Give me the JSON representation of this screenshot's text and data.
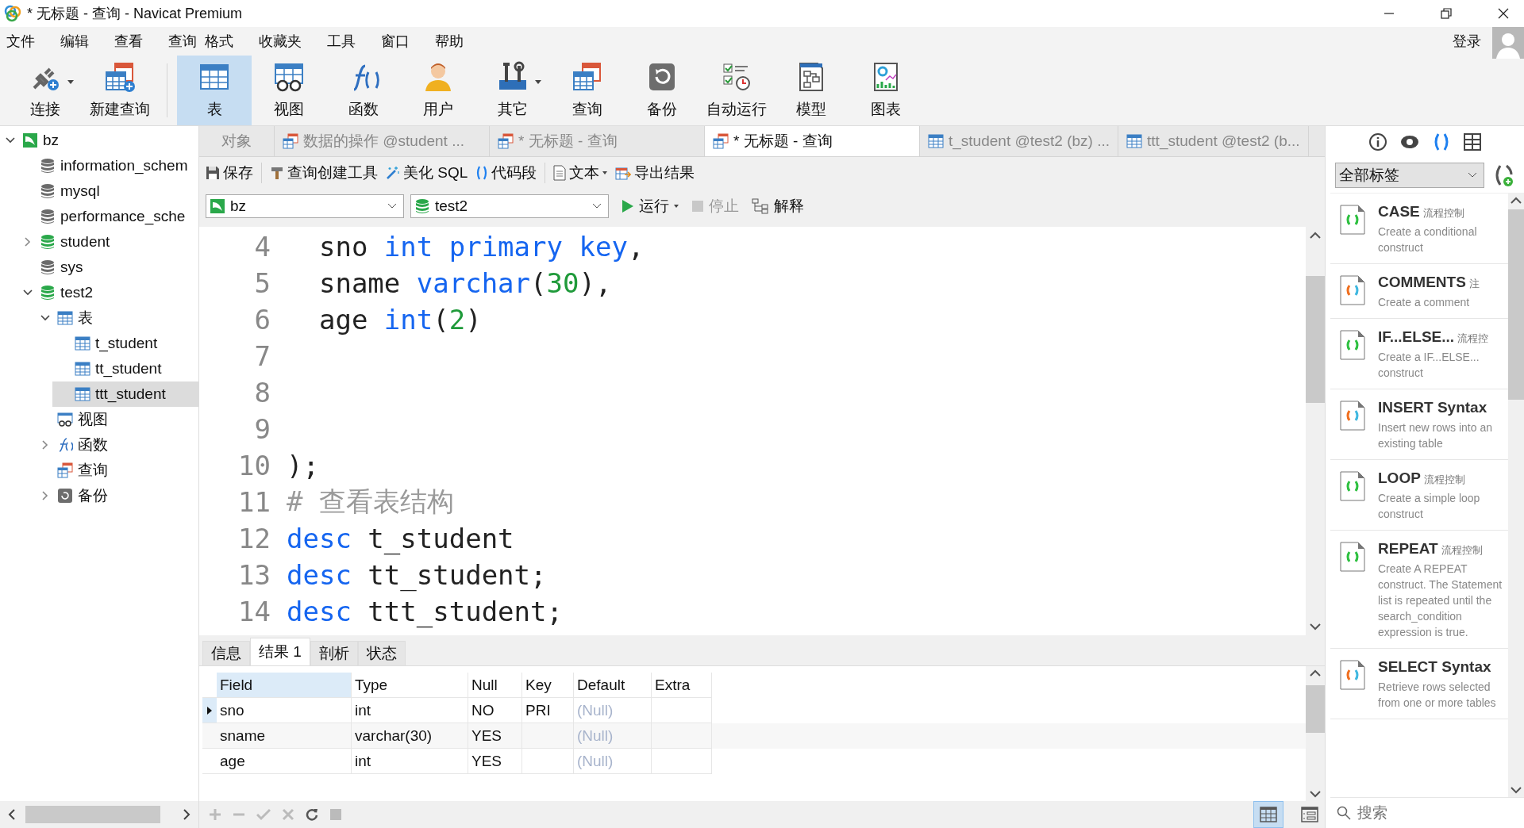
{
  "window": {
    "title": "* 无标题 - 查询 - Navicat Premium"
  },
  "menu": [
    "文件",
    "编辑",
    "查看",
    "查询",
    "格式",
    "收藏夹",
    "工具",
    "窗口",
    "帮助"
  ],
  "account": {
    "login": "登录"
  },
  "toolbar": [
    {
      "label": "连接",
      "kind": "connect",
      "dropdown": true,
      "selected": false
    },
    {
      "label": "新建查询",
      "kind": "newquery",
      "dropdown": false,
      "selected": false
    },
    {
      "label": "表",
      "kind": "table",
      "dropdown": false,
      "selected": true
    },
    {
      "label": "视图",
      "kind": "view",
      "dropdown": false,
      "selected": false
    },
    {
      "label": "函数",
      "kind": "function",
      "dropdown": false,
      "selected": false
    },
    {
      "label": "用户",
      "kind": "user",
      "dropdown": false,
      "selected": false
    },
    {
      "label": "其它",
      "kind": "tools",
      "dropdown": true,
      "selected": false
    },
    {
      "label": "查询",
      "kind": "query",
      "dropdown": false,
      "selected": false
    },
    {
      "label": "备份",
      "kind": "backup",
      "dropdown": false,
      "selected": false
    },
    {
      "label": "自动运行",
      "kind": "autorun",
      "dropdown": false,
      "selected": false
    },
    {
      "label": "模型",
      "kind": "model",
      "dropdown": false,
      "selected": false
    },
    {
      "label": "图表",
      "kind": "chart",
      "dropdown": false,
      "selected": false
    }
  ],
  "tree": [
    {
      "label": "bz",
      "kind": "connection",
      "expanded": true,
      "selected": false,
      "children": [
        {
          "label": "information_schem",
          "kind": "database",
          "selected": false
        },
        {
          "label": "mysql",
          "kind": "database",
          "selected": false
        },
        {
          "label": "performance_sche",
          "kind": "database",
          "selected": false
        },
        {
          "label": "student",
          "kind": "database-open",
          "expanded": false,
          "selected": false
        },
        {
          "label": "sys",
          "kind": "database",
          "selected": false
        },
        {
          "label": "test2",
          "kind": "database-open",
          "expanded": true,
          "selected": false,
          "children": [
            {
              "label": "表",
              "kind": "table",
              "expanded": true,
              "selected": false,
              "children": [
                {
                  "label": "t_student",
                  "kind": "table",
                  "selected": false
                },
                {
                  "label": "tt_student",
                  "kind": "table",
                  "selected": false
                },
                {
                  "label": "ttt_student",
                  "kind": "table",
                  "selected": true
                }
              ]
            },
            {
              "label": "视图",
              "kind": "view",
              "selected": false
            },
            {
              "label": "函数",
              "kind": "function",
              "expanded": false,
              "selected": false
            },
            {
              "label": "查询",
              "kind": "query",
              "selected": false
            },
            {
              "label": "备份",
              "kind": "backup",
              "expanded": false,
              "selected": false
            }
          ]
        }
      ]
    }
  ],
  "doc_tabs": [
    {
      "label": "对象",
      "kind": "object",
      "selected": false
    },
    {
      "label": "数据的操作 @student ...",
      "kind": "query",
      "selected": false
    },
    {
      "label": "* 无标题 - 查询",
      "kind": "query",
      "selected": false
    },
    {
      "label": "* 无标题 - 查询",
      "kind": "query",
      "selected": true
    },
    {
      "label": "t_student @test2 (bz) ...",
      "kind": "table",
      "selected": false
    },
    {
      "label": "ttt_student @test2 (b...",
      "kind": "table",
      "selected": false
    }
  ],
  "query_toolbar": [
    {
      "label": "保存",
      "kind": "save",
      "dropdown": false
    },
    {
      "label": "查询创建工具",
      "kind": "builder",
      "dropdown": false
    },
    {
      "label": "美化 SQL",
      "kind": "beautify",
      "dropdown": false
    },
    {
      "label": "代码段",
      "kind": "snippet",
      "dropdown": false
    },
    {
      "label": "文本",
      "kind": "text",
      "dropdown": true
    },
    {
      "label": "导出结果",
      "kind": "export",
      "dropdown": false
    }
  ],
  "connection_select": {
    "value": "bz"
  },
  "database_select": {
    "value": "test2"
  },
  "run_controls": [
    {
      "label": "运行",
      "kind": "run",
      "dropdown": true,
      "disabled": false
    },
    {
      "label": "停止",
      "kind": "stop",
      "dropdown": false,
      "disabled": true
    },
    {
      "label": "解释",
      "kind": "explain",
      "dropdown": false,
      "disabled": false
    }
  ],
  "editor": {
    "lines": [
      {
        "number": "4",
        "tokens": [
          {
            "text": "  sno ",
            "kind": "plain"
          },
          {
            "text": "int primary key",
            "kind": "keyword"
          },
          {
            "text": ",",
            "kind": "plain"
          }
        ]
      },
      {
        "number": "5",
        "tokens": [
          {
            "text": "  sname ",
            "kind": "plain"
          },
          {
            "text": "varchar",
            "kind": "keyword"
          },
          {
            "text": "(",
            "kind": "plain"
          },
          {
            "text": "30",
            "kind": "number"
          },
          {
            "text": "),",
            "kind": "plain"
          }
        ]
      },
      {
        "number": "6",
        "tokens": [
          {
            "text": "  age ",
            "kind": "plain"
          },
          {
            "text": "int",
            "kind": "keyword"
          },
          {
            "text": "(",
            "kind": "plain"
          },
          {
            "text": "2",
            "kind": "number"
          },
          {
            "text": ")",
            "kind": "plain"
          }
        ]
      },
      {
        "number": "7"
      },
      {
        "number": "8"
      },
      {
        "number": "9"
      },
      {
        "number": "10",
        "tokens": [
          {
            "text": ");",
            "kind": "plain"
          }
        ]
      },
      {
        "number": "11",
        "tokens": [
          {
            "text": "# 查看表结构",
            "kind": "comment"
          }
        ]
      },
      {
        "number": "12",
        "tokens": [
          {
            "text": "desc ",
            "kind": "keyword"
          },
          {
            "text": "t_student",
            "kind": "plain"
          }
        ]
      },
      {
        "number": "13",
        "tokens": [
          {
            "text": "desc ",
            "kind": "keyword"
          },
          {
            "text": "tt_student;",
            "kind": "plain"
          }
        ]
      },
      {
        "number": "14",
        "tokens": [
          {
            "text": "desc ",
            "kind": "keyword"
          },
          {
            "text": "ttt_student;",
            "kind": "plain"
          }
        ]
      }
    ]
  },
  "result_tabs": [
    {
      "label": "信息",
      "selected": false
    },
    {
      "label": "结果 1",
      "selected": true
    },
    {
      "label": "剖析",
      "selected": false
    },
    {
      "label": "状态",
      "selected": false
    }
  ],
  "result_table": {
    "columns": [
      {
        "label": "Field",
        "selected": true
      },
      {
        "label": "Type",
        "selected": false
      },
      {
        "label": "Null",
        "selected": false
      },
      {
        "label": "Key",
        "selected": false
      },
      {
        "label": "Default",
        "selected": false
      },
      {
        "label": "Extra",
        "selected": false
      }
    ],
    "rows": [
      {
        "selected": true,
        "cells": [
          "sno",
          "int",
          "NO",
          "PRI",
          {
            "text": "(Null)",
            "is_null": true
          }
        ]
      },
      {
        "selected": false,
        "cells": [
          "sname",
          "varchar(30)",
          "YES",
          "",
          {
            "text": "(Null)",
            "is_null": true
          }
        ]
      },
      {
        "selected": false,
        "cells": [
          "age",
          "int",
          "YES",
          "",
          {
            "text": "(Null)",
            "is_null": true
          }
        ]
      }
    ]
  },
  "view_modes": [
    {
      "kind": "grid",
      "selected": true
    },
    {
      "kind": "form",
      "selected": false
    }
  ],
  "side_panel": {
    "tabs": [
      {
        "kind": "info",
        "selected": false
      },
      {
        "kind": "preview",
        "selected": false
      },
      {
        "kind": "snippets",
        "selected": true
      },
      {
        "kind": "layout",
        "selected": false
      }
    ],
    "filter": {
      "value": "全部标签"
    },
    "snippets": [
      {
        "title": "CASE",
        "tag": "流程控制",
        "description": "Create a conditional construct",
        "kind": "flow"
      },
      {
        "title": "COMMENTS",
        "tag": "注",
        "description": "Create a comment",
        "kind": "syntax"
      },
      {
        "title": "IF...ELSE...",
        "tag": "流程控",
        "description": "Create a IF...ELSE... construct",
        "kind": "flow"
      },
      {
        "title": "INSERT Syntax",
        "description": "Insert new rows into an existing table",
        "kind": "syntax"
      },
      {
        "title": "LOOP",
        "tag": "流程控制",
        "description": "Create a simple loop construct",
        "kind": "flow"
      },
      {
        "title": "REPEAT",
        "tag": "流程控制",
        "description": "Create A REPEAT construct. The Statement list is repeated until the search_condition expression is true.",
        "kind": "flow"
      },
      {
        "title": "SELECT Syntax",
        "description": "Retrieve rows selected from one or more tables",
        "kind": "syntax"
      }
    ],
    "search": {
      "placeholder": "搜索"
    }
  }
}
